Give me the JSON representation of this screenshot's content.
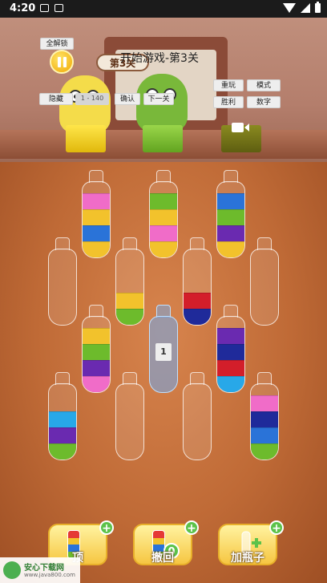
{
  "status_bar": {
    "time": "4:20"
  },
  "header": {
    "unlock_all": "全解锁",
    "hide": "隐藏",
    "level_range_placeholder": "1 - 140",
    "confirm": "确认",
    "next_level": "下一关",
    "replay": "重玩",
    "mode": "模式",
    "win": "胜利",
    "number": "数字",
    "level_pill": "第3关",
    "title": "开始游戏-第3关"
  },
  "colors": {
    "pink": "#f06cc8",
    "yellow": "#f2c22c",
    "blue": "#2a73d8",
    "green": "#6dbb2c",
    "purple": "#6a2ab0",
    "red": "#d31e2a",
    "navy": "#1f2a9a",
    "cyan": "#28a8e8",
    "magenta": "#e050b8"
  },
  "bottles": [
    {
      "id": "bottle-1",
      "layers": [
        "yellow",
        "blue",
        "yellow",
        "pink"
      ]
    },
    {
      "id": "bottle-2",
      "layers": [
        "yellow",
        "pink",
        "yellow",
        "green"
      ]
    },
    {
      "id": "bottle-3",
      "layers": [
        "yellow",
        "purple",
        "green",
        "blue"
      ]
    },
    {
      "id": "bottle-4",
      "layers": []
    },
    {
      "id": "bottle-5",
      "layers": [
        "green",
        "yellow"
      ]
    },
    {
      "id": "bottle-6",
      "layers": [
        "navy",
        "red"
      ]
    },
    {
      "id": "bottle-7",
      "layers": []
    },
    {
      "id": "bottle-8",
      "layers": [
        "pink",
        "purple",
        "green",
        "yellow"
      ]
    },
    {
      "id": "bottle-9",
      "special": true,
      "tag": "1",
      "layers": []
    },
    {
      "id": "bottle-10",
      "layers": [
        "cyan",
        "red",
        "navy",
        "purple"
      ]
    },
    {
      "id": "bottle-11",
      "layers": [
        "green",
        "purple",
        "cyan"
      ]
    },
    {
      "id": "bottle-12",
      "layers": []
    },
    {
      "id": "bottle-13",
      "layers": []
    },
    {
      "id": "bottle-14",
      "layers": [
        "green",
        "blue",
        "navy",
        "pink"
      ]
    }
  ],
  "tools": [
    {
      "label": "顶",
      "plus": "+",
      "icon": "rainbow-bottle-icon"
    },
    {
      "label": "撤回",
      "plus": "+",
      "count": "0",
      "icon": "undo-icon"
    },
    {
      "label": "加瓶子",
      "plus": "+",
      "icon": "add-bottle-icon"
    }
  ],
  "watermark": {
    "name": "安心下载网",
    "url": "www.java800.com"
  }
}
